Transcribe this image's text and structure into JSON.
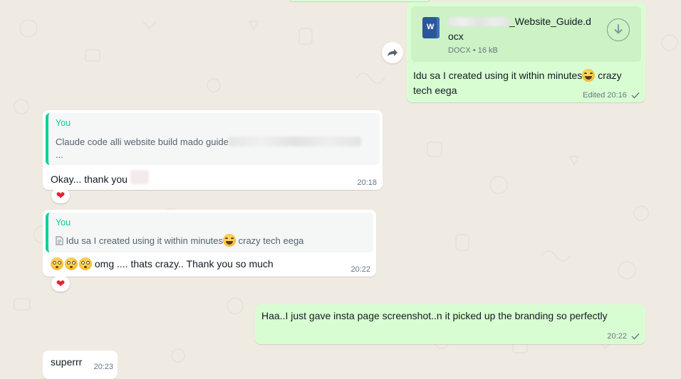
{
  "doc_message": {
    "file_name_visible": "_Website_Guide.d",
    "file_name_wrap": "ocx",
    "file_meta": "DOCX • 16 kB",
    "word_icon_letter": "W",
    "caption": "Idu sa I created using it within minutes",
    "caption_end": " crazy",
    "caption_line2": "tech eega",
    "time": "Edited 20:16"
  },
  "reply_1": {
    "quote_author": "You",
    "quote_text": "Claude code alli website build mado guide",
    "quote_ellipsis": "...",
    "text": "Okay... thank you",
    "time": "20:18",
    "reaction": "❤"
  },
  "reply_2": {
    "quote_author": "You",
    "quote_text": "Idu sa I created using it within minutes",
    "quote_text_end": " crazy tech eega",
    "text": " omg .... thats crazy.. Thank you so much",
    "time": "20:22",
    "reaction": "❤"
  },
  "out_message": {
    "text": "Haa..I just gave insta page screenshot..n it picked up the branding so perfectly",
    "time": "20:22"
  },
  "last_message": {
    "text": "superrr",
    "time": "20:23"
  },
  "colors": {
    "wallpaper": "#efeae2",
    "outgoing_bubble": "#d9fdd3",
    "incoming_bubble": "#ffffff",
    "quote_accent": "#06cf9c",
    "reaction_heart": "#e8222f",
    "word_blue": "#2b579a"
  }
}
